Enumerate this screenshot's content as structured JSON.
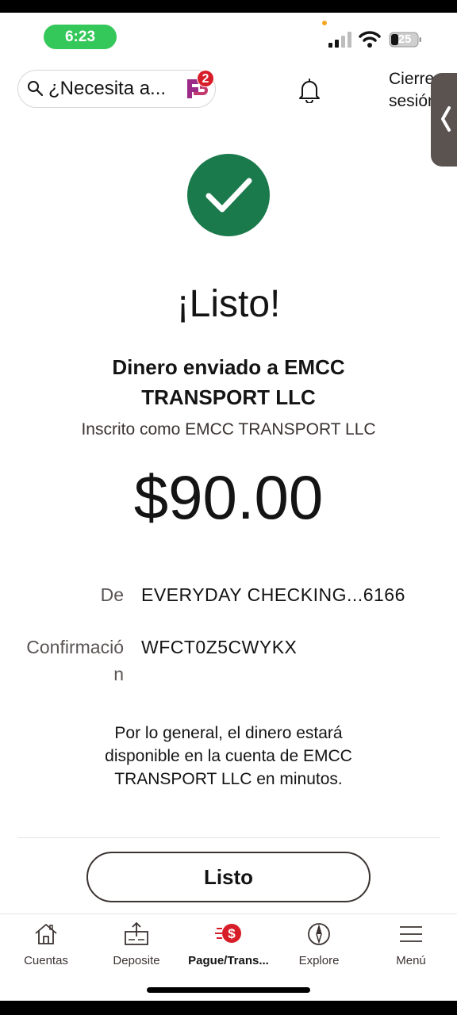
{
  "status_bar": {
    "time": "6:23",
    "battery": "25"
  },
  "header": {
    "search_text": "¿Necesita a...",
    "fargo_badge": "2",
    "signout_line1": "Cierre",
    "signout_line2": "sesión"
  },
  "content": {
    "title": "¡Listo!",
    "sent_to": "Dinero enviado a EMCC TRANSPORT LLC",
    "enrolled_as": "Inscrito como EMCC TRANSPORT LLC",
    "amount": "$90.00",
    "from_label": "De",
    "from_value": "EVERYDAY CHECKING...6166",
    "confirmation_label": "Confirmación",
    "confirmation_value": "WFCT0Z5CWYKX",
    "availability_note": "Por lo general, el dinero estará disponible en la cuenta de EMCC TRANSPORT LLC en minutos.",
    "done_button": "Listo"
  },
  "tabbar": {
    "items": [
      {
        "label": "Cuentas",
        "icon": "home-icon"
      },
      {
        "label": "Deposite",
        "icon": "deposit-icon"
      },
      {
        "label": "Pague/Trans...",
        "icon": "pay-transfer-icon",
        "active": true
      },
      {
        "label": "Explore",
        "icon": "compass-icon"
      },
      {
        "label": "Menú",
        "icon": "menu-icon"
      }
    ]
  },
  "colors": {
    "success_green": "#1a7a4c",
    "status_green": "#34c759",
    "brand_red": "#d71e28",
    "fargo_purple": "#9b2b87"
  }
}
